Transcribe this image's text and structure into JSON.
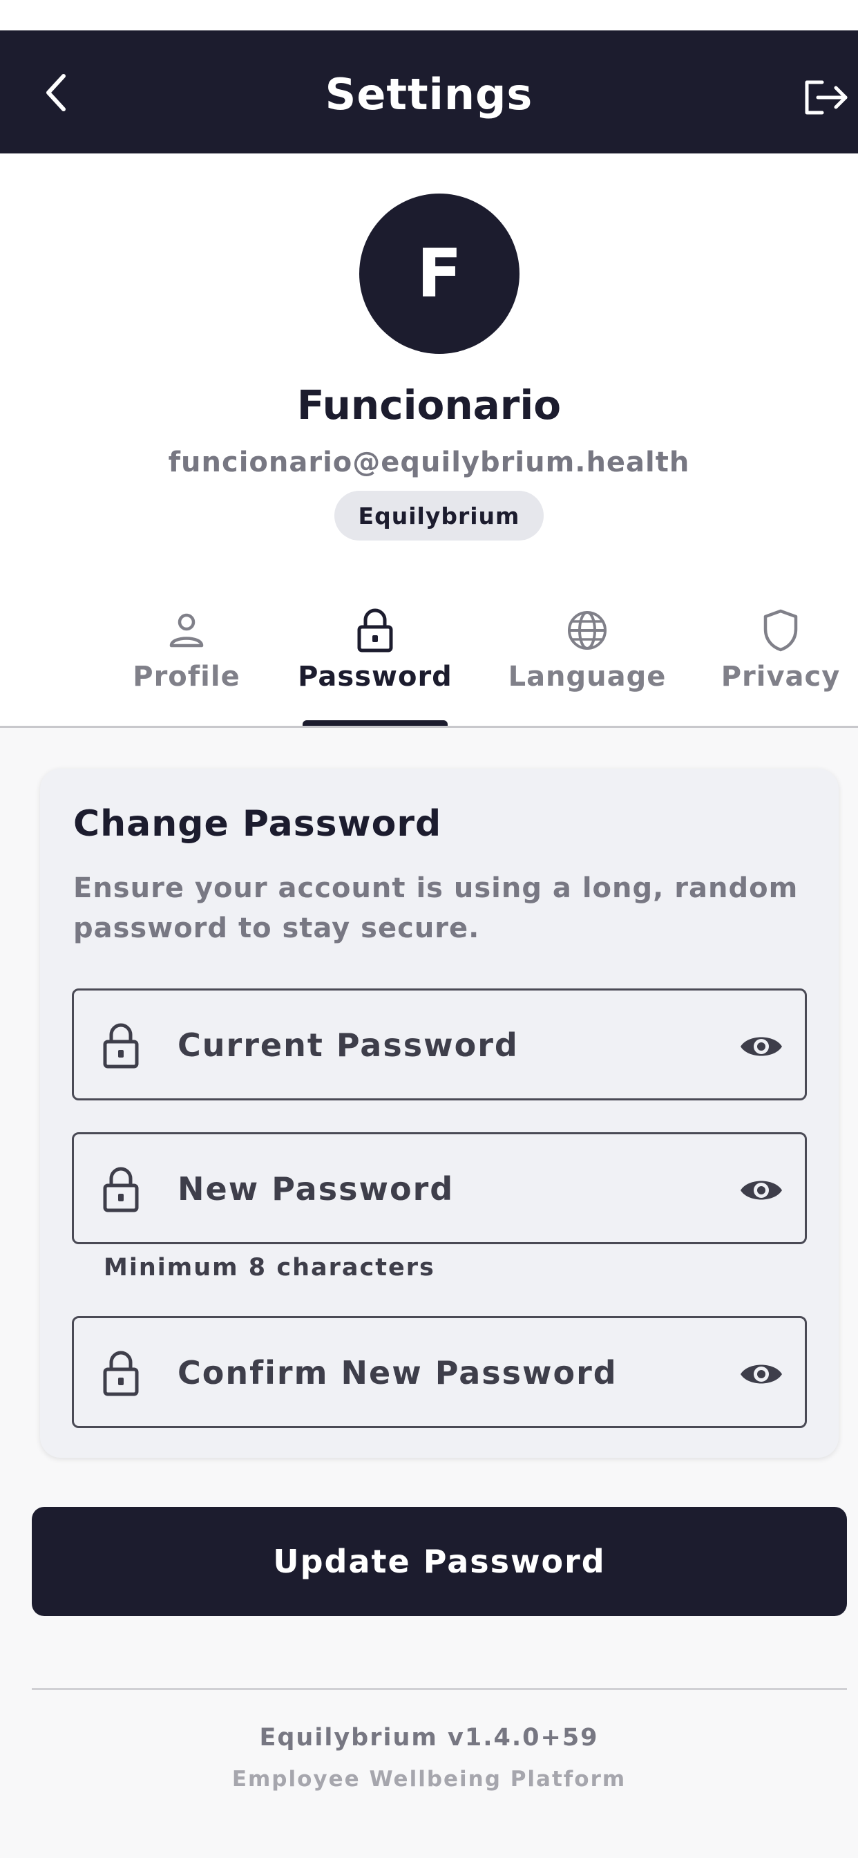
{
  "header": {
    "title": "Settings",
    "back_icon": "chevron-left-icon",
    "logout_icon": "logout-icon"
  },
  "profile": {
    "avatar_initial": "F",
    "name": "Funcionario",
    "email": "funcionario@equilybrium.health",
    "organization": "Equilybrium"
  },
  "tabs": [
    {
      "label": "Profile",
      "icon": "person-icon",
      "active": false
    },
    {
      "label": "Password",
      "icon": "lock-icon",
      "active": true
    },
    {
      "label": "Language",
      "icon": "globe-icon",
      "active": false
    },
    {
      "label": "Privacy",
      "icon": "shield-icon",
      "active": false
    }
  ],
  "change_password": {
    "title": "Change Password",
    "description": "Ensure your account is using a long, random password to stay secure.",
    "fields": [
      {
        "placeholder": "Current Password",
        "icon": "lock-icon",
        "toggle_icon": "eye-icon"
      },
      {
        "placeholder": "New Password",
        "icon": "lock-icon",
        "toggle_icon": "eye-icon",
        "helper": "Minimum 8 characters"
      },
      {
        "placeholder": "Confirm New Password",
        "icon": "lock-icon",
        "toggle_icon": "eye-icon"
      }
    ]
  },
  "actions": {
    "update_label": "Update Password"
  },
  "footer": {
    "version": "Equilybrium v1.4.0+59",
    "tagline": "Employee Wellbeing Platform"
  },
  "colors": {
    "primary": "#1c1c2e",
    "background": "#f8f8f9",
    "card": "#f0f1f5",
    "muted_text": "#777782"
  }
}
